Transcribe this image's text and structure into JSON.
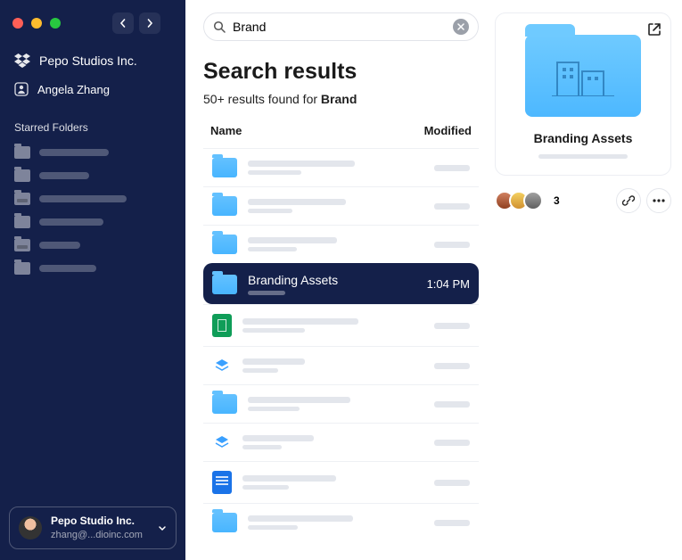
{
  "workspace": {
    "name": "Pepo Studios Inc."
  },
  "user": {
    "name": "Angela Zhang"
  },
  "sidebar": {
    "starred_label": "Starred Folders",
    "starred": [
      {
        "hasbar": false,
        "w": 78
      },
      {
        "hasbar": false,
        "w": 56
      },
      {
        "hasbar": true,
        "w": 98
      },
      {
        "hasbar": false,
        "w": 72
      },
      {
        "hasbar": true,
        "w": 46
      },
      {
        "hasbar": false,
        "w": 64
      }
    ]
  },
  "account": {
    "name": "Pepo Studio Inc.",
    "email": "zhang@...dioinc.com"
  },
  "search": {
    "query": "Brand",
    "placeholder": "Search"
  },
  "results": {
    "heading": "Search results",
    "count_prefix": "50+ results found for ",
    "term": "Brand",
    "columns": {
      "name": "Name",
      "modified": "Modified"
    },
    "items": [
      {
        "type": "folder",
        "name_w": 120,
        "sub_w": 60
      },
      {
        "type": "folder",
        "name_w": 110,
        "sub_w": 50
      },
      {
        "type": "folder",
        "name_w": 100,
        "sub_w": 55
      },
      {
        "type": "folder",
        "name": "Branding Assets",
        "modified": "1:04 PM",
        "selected": true,
        "sub_w": 42
      },
      {
        "type": "sheet",
        "name_w": 130,
        "sub_w": 70
      },
      {
        "type": "layer",
        "name_w": 70,
        "sub_w": 40
      },
      {
        "type": "folder",
        "name_w": 115,
        "sub_w": 58
      },
      {
        "type": "layer",
        "name_w": 80,
        "sub_w": 44
      },
      {
        "type": "doc",
        "name_w": 105,
        "sub_w": 52
      },
      {
        "type": "folder",
        "name_w": 118,
        "sub_w": 56
      }
    ]
  },
  "preview": {
    "title": "Branding Assets",
    "avatar_count": "3"
  }
}
